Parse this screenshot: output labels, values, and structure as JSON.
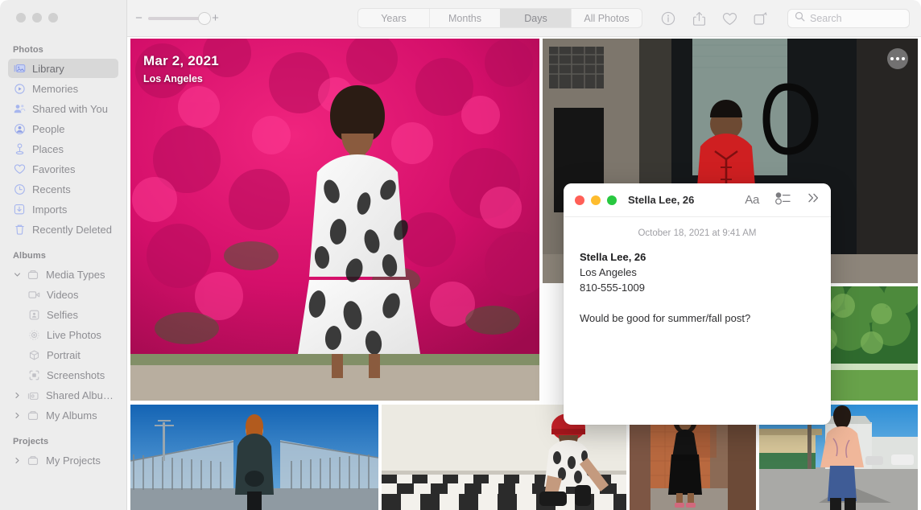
{
  "app": {
    "name": "Photos",
    "window_controls": [
      "close",
      "minimize",
      "zoom"
    ]
  },
  "sidebar": {
    "sections": [
      {
        "title": "Photos",
        "items": [
          {
            "label": "Library",
            "icon": "library-icon",
            "selected": true
          },
          {
            "label": "Memories",
            "icon": "memories-icon",
            "selected": false
          },
          {
            "label": "Shared with You",
            "icon": "shared-with-you-icon",
            "selected": false
          },
          {
            "label": "People",
            "icon": "people-icon",
            "selected": false
          },
          {
            "label": "Places",
            "icon": "places-pin-icon",
            "selected": false
          },
          {
            "label": "Favorites",
            "icon": "heart-icon",
            "selected": false
          },
          {
            "label": "Recents",
            "icon": "clock-icon",
            "selected": false
          },
          {
            "label": "Imports",
            "icon": "import-arrow-icon",
            "selected": false
          },
          {
            "label": "Recently Deleted",
            "icon": "trash-icon",
            "selected": false
          }
        ]
      },
      {
        "title": "Albums",
        "items": [
          {
            "label": "Media Types",
            "icon": "folder-icon",
            "disclosure": "expanded",
            "indent": 0
          },
          {
            "label": "Videos",
            "icon": "video-icon",
            "indent": 1
          },
          {
            "label": "Selfies",
            "icon": "selfie-icon",
            "indent": 1
          },
          {
            "label": "Live Photos",
            "icon": "live-photo-icon",
            "indent": 1
          },
          {
            "label": "Portrait",
            "icon": "portrait-icon",
            "indent": 1
          },
          {
            "label": "Screenshots",
            "icon": "screenshot-icon",
            "indent": 1
          },
          {
            "label": "Shared Albums",
            "icon": "shared-albums-icon",
            "disclosure": "collapsed",
            "indent": 0
          },
          {
            "label": "My Albums",
            "icon": "folder-icon",
            "disclosure": "collapsed",
            "indent": 0
          }
        ]
      },
      {
        "title": "Projects",
        "items": [
          {
            "label": "My Projects",
            "icon": "folder-icon",
            "disclosure": "collapsed",
            "indent": 0
          }
        ]
      }
    ]
  },
  "toolbar": {
    "zoom_minus": "−",
    "zoom_plus": "+",
    "zoom_value": 85,
    "segments": [
      {
        "label": "Years",
        "active": false
      },
      {
        "label": "Months",
        "active": false
      },
      {
        "label": "Days",
        "active": true
      },
      {
        "label": "All Photos",
        "active": false
      }
    ],
    "icons": [
      {
        "name": "info-icon"
      },
      {
        "name": "share-icon"
      },
      {
        "name": "favorite-heart-icon"
      },
      {
        "name": "rotate-icon"
      }
    ],
    "search": {
      "placeholder": "Search",
      "value": "",
      "icon": "search-icon"
    }
  },
  "grid": {
    "date_overlay": {
      "date": "Mar 2, 2021",
      "location": "Los Angeles"
    },
    "more_button_label": "More options",
    "photos": [
      {
        "alt": "Woman in patterned dress in front of bougainvillea",
        "theme": "bougainvillea"
      },
      {
        "alt": "Person in red jacket in doorway",
        "theme": "red-doorway"
      },
      {
        "alt": "Person in yellow top and purple pants by greenery",
        "theme": "garden"
      },
      {
        "alt": "Woman on pedestrian bridge in blue coat",
        "theme": "bridge"
      },
      {
        "alt": "Woman in red hat sitting on checkered floor",
        "theme": "checkerboard"
      },
      {
        "alt": "Woman in black dress against brick wall",
        "theme": "brick-wall"
      },
      {
        "alt": "Woman in pink jacket on street",
        "theme": "street"
      }
    ]
  },
  "notes": {
    "window_title": "Stella Lee, 26",
    "window_controls": [
      "close",
      "minimize",
      "zoom"
    ],
    "actions": [
      {
        "name": "format-aa-icon",
        "label": "Aa"
      },
      {
        "name": "checklist-icon",
        "label": ""
      },
      {
        "name": "expand-chevrons-icon",
        "label": "»"
      }
    ],
    "timestamp": "October 18, 2021 at 9:41 AM",
    "content": {
      "title": "Stella Lee, 26",
      "line_location": "Los Angeles",
      "line_phone": "810-555-1009",
      "line_note": "Would be good for summer/fall post?"
    }
  },
  "colors": {
    "accent": "#3b82f6",
    "sidebar_bg": "#ededed",
    "toolbar_bg": "#f2f2f2",
    "selected_row": "#d8d8d8",
    "traffic_red": "#ff5f57",
    "traffic_yellow": "#febc2e",
    "traffic_green": "#28c840"
  }
}
